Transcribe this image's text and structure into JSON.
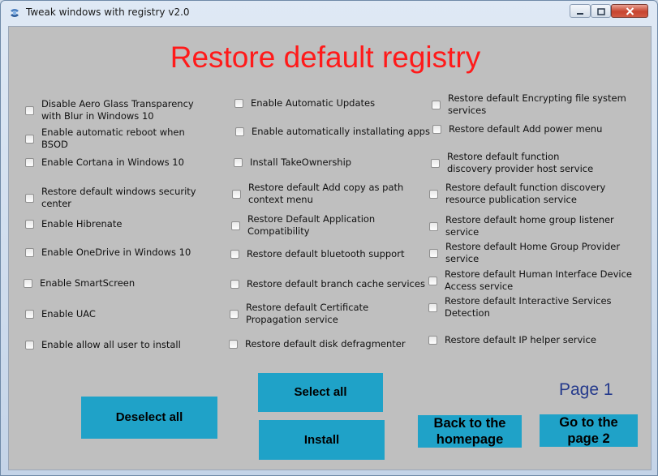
{
  "window": {
    "title": "Tweak windows with registry v2.0",
    "controls": {
      "minimize": "minimize-icon",
      "maximize": "maximize-icon",
      "close": "close-icon"
    }
  },
  "heading": "Restore default registry",
  "page_label": "Page 1",
  "colors": {
    "heading": "#ff1a1a",
    "button_bg": "#1fa2c8",
    "page_label": "#253a8c",
    "client_bg": "#bfbfbf"
  },
  "columns": [
    {
      "options": [
        {
          "label": "Disable Aero Glass Transparency\nwith Blur in Windows 10",
          "checked": false
        },
        {
          "label": "Enable automatic reboot when\nBSOD",
          "checked": false
        },
        {
          "label": "Enable Cortana in Windows 10",
          "checked": false
        },
        {
          "label": "Restore default windows security\ncenter",
          "checked": false
        },
        {
          "label": "Enable Hibrenate",
          "checked": false
        },
        {
          "label": "Enable OneDrive in Windows 10",
          "checked": false
        },
        {
          "label": "Enable SmartScreen",
          "checked": false
        },
        {
          "label": "Enable UAC",
          "checked": false
        },
        {
          "label": "Enable allow all user to install",
          "checked": false
        }
      ]
    },
    {
      "options": [
        {
          "label": "Enable Automatic Updates",
          "checked": false
        },
        {
          "label": "Enable automatically installating apps",
          "checked": false
        },
        {
          "label": "Install TakeOwnership",
          "checked": false
        },
        {
          "label": "Restore default Add copy as path\ncontext menu",
          "checked": false
        },
        {
          "label": "Restore Default Application\nCompatibility",
          "checked": false
        },
        {
          "label": "Restore default bluetooth support",
          "checked": false
        },
        {
          "label": "Restore default branch cache services",
          "checked": false
        },
        {
          "label": "Restore default Certificate\nPropagation service",
          "checked": false
        },
        {
          "label": "Restore default disk defragmenter",
          "checked": false
        }
      ]
    },
    {
      "options": [
        {
          "label": "Restore default Encrypting file system\nservices",
          "checked": false
        },
        {
          "label": "Restore default Add power menu",
          "checked": false
        },
        {
          "label": "Restore default function\ndiscovery provider host service",
          "checked": false
        },
        {
          "label": "Restore default function discovery\nresource publication service",
          "checked": false
        },
        {
          "label": "Restore default home group listener\nservice",
          "checked": false
        },
        {
          "label": "Restore default Home Group Provider\nservice",
          "checked": false
        },
        {
          "label": "Restore default Human Interface Device\nAccess service",
          "checked": false
        },
        {
          "label": "Restore default Interactive Services\nDetection",
          "checked": false
        },
        {
          "label": "Restore default IP helper service",
          "checked": false
        }
      ]
    }
  ],
  "buttons": {
    "deselect_all": "Deselect all",
    "select_all": "Select all",
    "install": "Install",
    "back_home": "Back to the\nhomepage",
    "next_page": "Go to the\npage 2"
  }
}
